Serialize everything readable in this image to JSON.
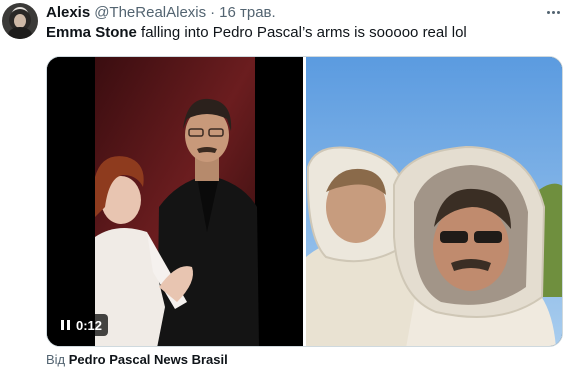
{
  "tweet": {
    "display_name": "Alexis",
    "handle": "@TheRealAlexis",
    "separator": "·",
    "date": "16 трав.",
    "text_bold": "Emma Stone",
    "text_rest": " falling into Pedro Pascal’s arms is sooooo real lol"
  },
  "media": {
    "video_time": "0:12"
  },
  "attribution": {
    "prefix": "Від ",
    "source": "Pedro Pascal News Brasil"
  },
  "icons": {
    "more": "more-horizontal-icon",
    "pause": "pause-icon"
  },
  "colors": {
    "text": "#0f1419",
    "secondary": "#536471",
    "border": "#cfd9de"
  }
}
